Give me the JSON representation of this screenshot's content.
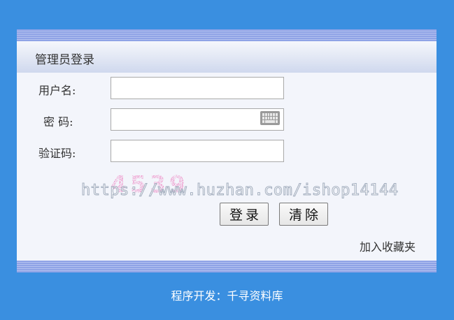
{
  "header": {
    "title": "管理员登录"
  },
  "form": {
    "username_label": "用户名:",
    "username_value": "",
    "password_label": "密 码:",
    "password_value": "",
    "captcha_label": "验证码:",
    "captcha_value": "",
    "captcha_text": "4539"
  },
  "buttons": {
    "login_label": "登录",
    "clear_label": "清除"
  },
  "links": {
    "favorite_label": "加入收藏夹"
  },
  "watermark": {
    "text": "https://www.huzhan.com/ishop14144"
  },
  "footer": {
    "text": "程序开发：千寻资料库"
  },
  "icons": {
    "keyboard": "keyboard-icon"
  },
  "colors": {
    "background": "#3a8fe0",
    "panel": "#f3f5fb",
    "stripe": "#8fa3e6",
    "captcha": "#e8208e"
  }
}
